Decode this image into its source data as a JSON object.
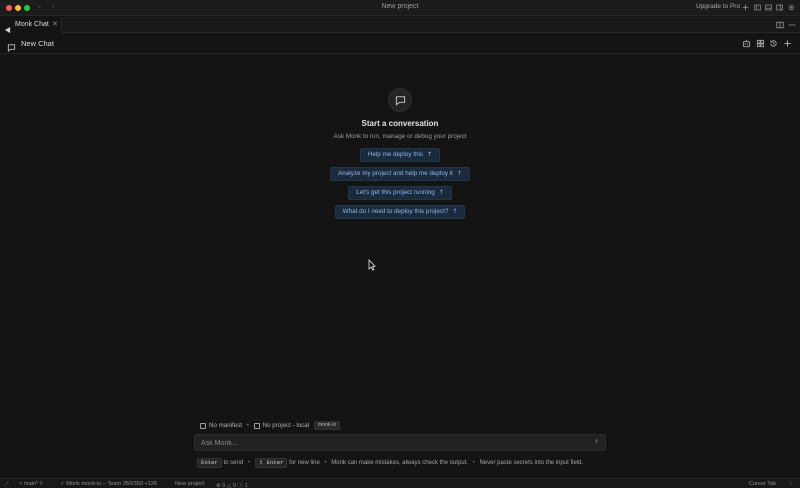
{
  "window": {
    "title": "New project",
    "upgrade_label": "Upgrade to Pro"
  },
  "tabs": [
    {
      "label": "Monk Chat",
      "active": true
    }
  ],
  "chat_header": {
    "title": "New Chat"
  },
  "empty_state": {
    "title": "Start a conversation",
    "subtitle": "Ask Monk to run, manage or debug your project",
    "suggestions": [
      "Help me deploy this",
      "Analyze my project and help me deploy it",
      "Let's get this project running",
      "What do I need to deploy this project?"
    ]
  },
  "context": {
    "manifest": "No manifest",
    "project": "No project - local",
    "badge": "monk-io"
  },
  "input": {
    "placeholder": "Ask Monk..."
  },
  "hints": {
    "enter_key": "Enter",
    "enter_text": "to send",
    "shift_enter_key": "⇧ Enter",
    "shift_enter_text": "for new line",
    "warning": "Monk can make mistakes, always check the output.",
    "secrets": "Never paste secrets into the input field."
  },
  "status_bar": {
    "branch": "main*",
    "account": "Monk monk-io – Team 350/350 +126",
    "project": "New project",
    "errors": "0",
    "warnings": "0",
    "info": "1",
    "cursor_tab": "Cursor Tab"
  },
  "colors": {
    "background": "#141414",
    "suggestion_bg": "#1b2a3d",
    "suggestion_text": "#8fb7ea"
  }
}
